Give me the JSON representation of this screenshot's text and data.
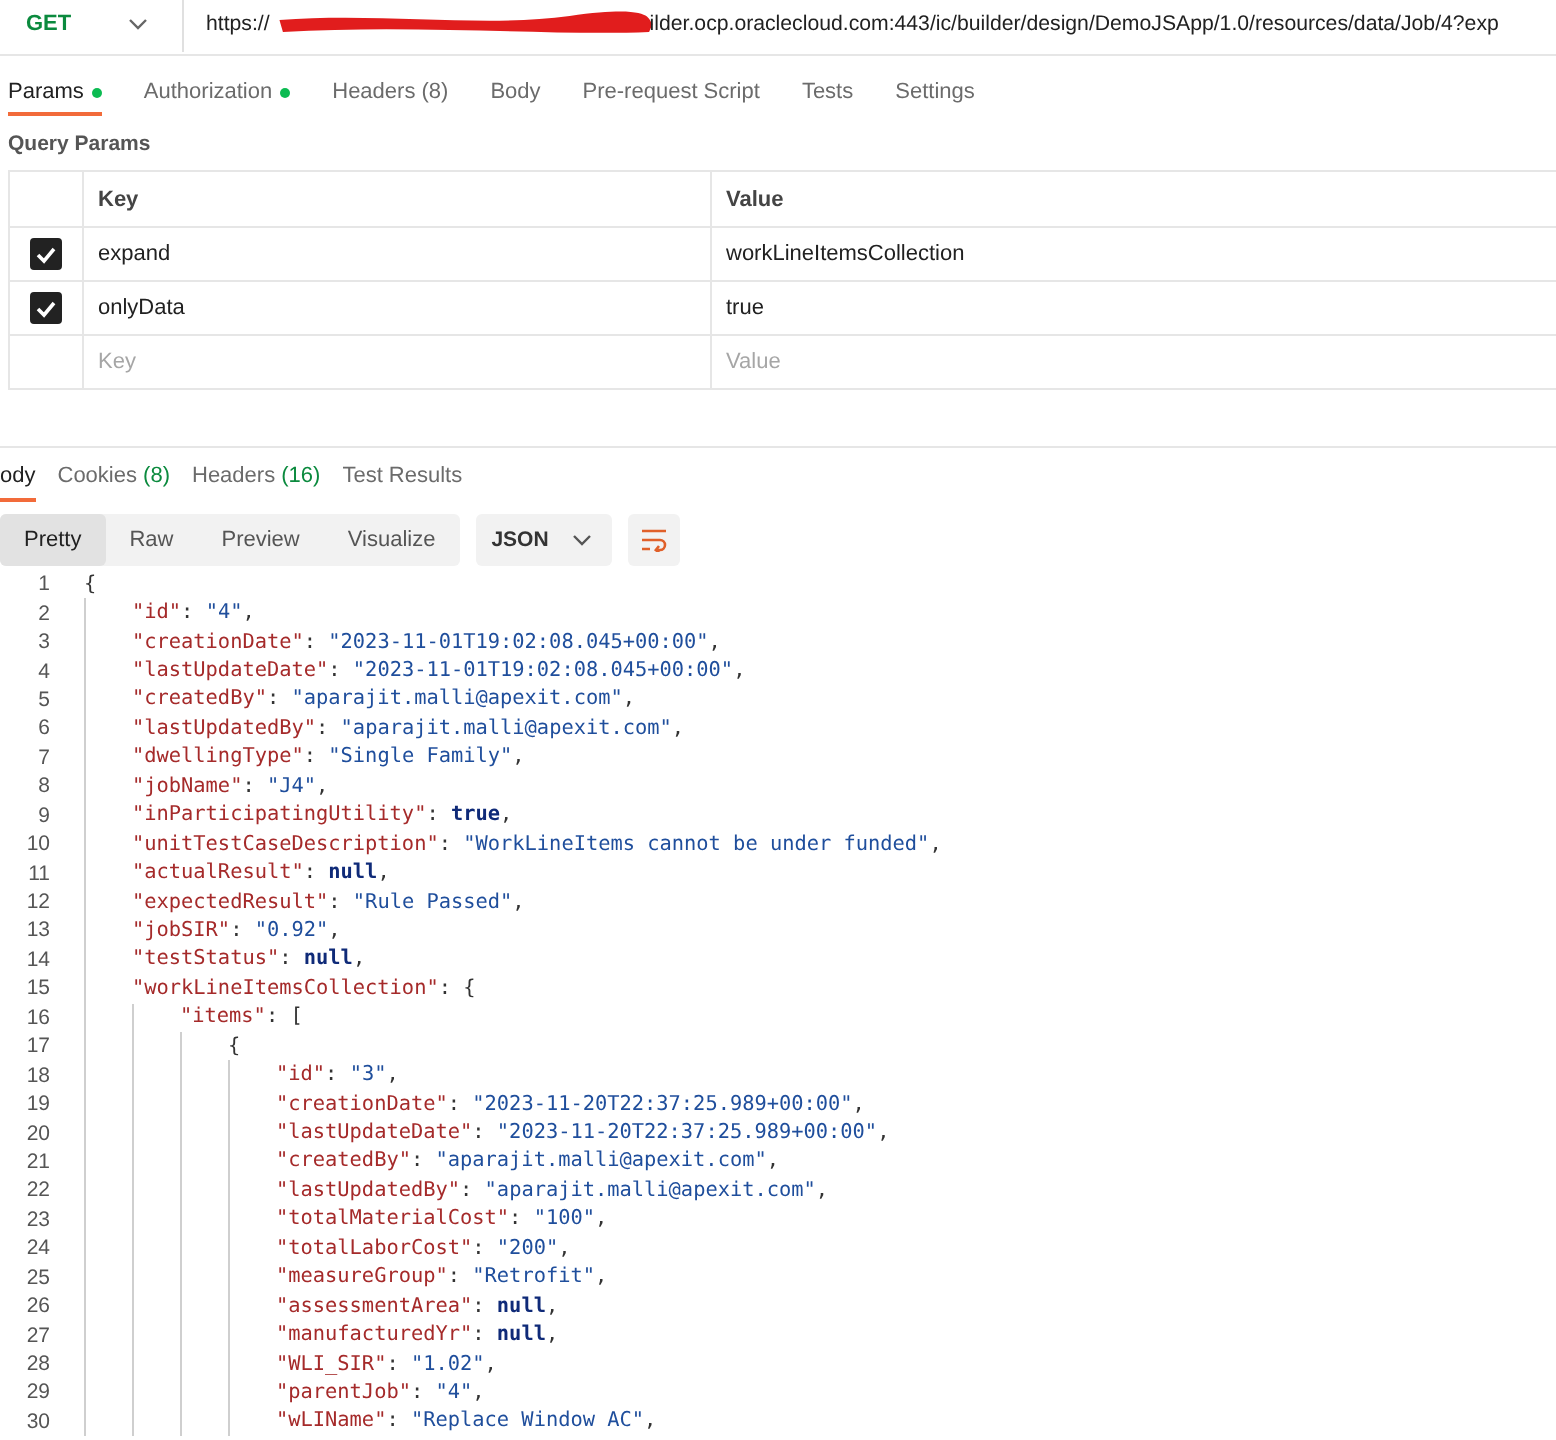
{
  "request": {
    "method": "GET",
    "url_start": "https://",
    "url_end": "ilder.ocp.oraclecloud.com:443/ic/builder/design/DemoJSApp/1.0/resources/data/Job/4?exp"
  },
  "request_tabs": [
    {
      "label": "Params",
      "selected": true,
      "dot": true
    },
    {
      "label": "Authorization",
      "selected": false,
      "dot": true
    },
    {
      "label": "Headers",
      "count": "(8)",
      "selected": false,
      "dot": false
    },
    {
      "label": "Body",
      "selected": false,
      "dot": false
    },
    {
      "label": "Pre-request Script",
      "selected": false,
      "dot": false
    },
    {
      "label": "Tests",
      "selected": false,
      "dot": false
    },
    {
      "label": "Settings",
      "selected": false,
      "dot": false
    }
  ],
  "query_params": {
    "title": "Query Params",
    "columns": [
      "Key",
      "Value"
    ],
    "rows": [
      {
        "checked": true,
        "key": "expand",
        "value": "workLineItemsCollection"
      },
      {
        "checked": true,
        "key": "onlyData",
        "value": "true"
      }
    ],
    "new_row": {
      "key_placeholder": "Key",
      "value_placeholder": "Value"
    }
  },
  "response_tabs": [
    {
      "label": "ody",
      "selected": true
    },
    {
      "label": "Cookies",
      "count": "(8)",
      "selected": false
    },
    {
      "label": "Headers",
      "count": "(16)",
      "selected": false
    },
    {
      "label": "Test Results",
      "selected": false
    }
  ],
  "view_modes": [
    {
      "label": "Pretty",
      "selected": true
    },
    {
      "label": "Raw",
      "selected": false
    },
    {
      "label": "Preview",
      "selected": false
    },
    {
      "label": "Visualize",
      "selected": false
    }
  ],
  "format": "JSON",
  "code": [
    {
      "n": "1",
      "tokens": [
        {
          "kind": "p",
          "text": "{"
        }
      ],
      "children": [
        {
          "n": "2",
          "tokens": [
            {
              "kind": "key",
              "text": "\"id\""
            },
            {
              "kind": "p",
              "text": ": "
            },
            {
              "kind": "str",
              "text": "\"4\""
            },
            {
              "kind": "p",
              "text": ","
            }
          ]
        },
        {
          "n": "3",
          "tokens": [
            {
              "kind": "key",
              "text": "\"creationDate\""
            },
            {
              "kind": "p",
              "text": ": "
            },
            {
              "kind": "str",
              "text": "\"2023-11-01T19:02:08.045+00:00\""
            },
            {
              "kind": "p",
              "text": ","
            }
          ]
        },
        {
          "n": "4",
          "tokens": [
            {
              "kind": "key",
              "text": "\"lastUpdateDate\""
            },
            {
              "kind": "p",
              "text": ": "
            },
            {
              "kind": "str",
              "text": "\"2023-11-01T19:02:08.045+00:00\""
            },
            {
              "kind": "p",
              "text": ","
            }
          ]
        },
        {
          "n": "5",
          "tokens": [
            {
              "kind": "key",
              "text": "\"createdBy\""
            },
            {
              "kind": "p",
              "text": ": "
            },
            {
              "kind": "str",
              "text": "\"aparajit.malli@apexit.com\""
            },
            {
              "kind": "p",
              "text": ","
            }
          ]
        },
        {
          "n": "6",
          "tokens": [
            {
              "kind": "key",
              "text": "\"lastUpdatedBy\""
            },
            {
              "kind": "p",
              "text": ": "
            },
            {
              "kind": "str",
              "text": "\"aparajit.malli@apexit.com\""
            },
            {
              "kind": "p",
              "text": ","
            }
          ]
        },
        {
          "n": "7",
          "tokens": [
            {
              "kind": "key",
              "text": "\"dwellingType\""
            },
            {
              "kind": "p",
              "text": ": "
            },
            {
              "kind": "str",
              "text": "\"Single Family\""
            },
            {
              "kind": "p",
              "text": ","
            }
          ]
        },
        {
          "n": "8",
          "tokens": [
            {
              "kind": "key",
              "text": "\"jobName\""
            },
            {
              "kind": "p",
              "text": ": "
            },
            {
              "kind": "str",
              "text": "\"J4\""
            },
            {
              "kind": "p",
              "text": ","
            }
          ]
        },
        {
          "n": "9",
          "tokens": [
            {
              "kind": "key",
              "text": "\"inParticipatingUtility\""
            },
            {
              "kind": "p",
              "text": ": "
            },
            {
              "kind": "kw",
              "text": "true"
            },
            {
              "kind": "p",
              "text": ","
            }
          ]
        },
        {
          "n": "10",
          "tokens": [
            {
              "kind": "key",
              "text": "\"unitTestCaseDescription\""
            },
            {
              "kind": "p",
              "text": ": "
            },
            {
              "kind": "str",
              "text": "\"WorkLineItems cannot be under funded\""
            },
            {
              "kind": "p",
              "text": ","
            }
          ]
        },
        {
          "n": "11",
          "tokens": [
            {
              "kind": "key",
              "text": "\"actualResult\""
            },
            {
              "kind": "p",
              "text": ": "
            },
            {
              "kind": "kw",
              "text": "null"
            },
            {
              "kind": "p",
              "text": ","
            }
          ]
        },
        {
          "n": "12",
          "tokens": [
            {
              "kind": "key",
              "text": "\"expectedResult\""
            },
            {
              "kind": "p",
              "text": ": "
            },
            {
              "kind": "str",
              "text": "\"Rule Passed\""
            },
            {
              "kind": "p",
              "text": ","
            }
          ]
        },
        {
          "n": "13",
          "tokens": [
            {
              "kind": "key",
              "text": "\"jobSIR\""
            },
            {
              "kind": "p",
              "text": ": "
            },
            {
              "kind": "str",
              "text": "\"0.92\""
            },
            {
              "kind": "p",
              "text": ","
            }
          ]
        },
        {
          "n": "14",
          "tokens": [
            {
              "kind": "key",
              "text": "\"testStatus\""
            },
            {
              "kind": "p",
              "text": ": "
            },
            {
              "kind": "kw",
              "text": "null"
            },
            {
              "kind": "p",
              "text": ","
            }
          ]
        },
        {
          "n": "15",
          "tokens": [
            {
              "kind": "key",
              "text": "\"workLineItemsCollection\""
            },
            {
              "kind": "p",
              "text": ": {"
            }
          ],
          "children": [
            {
              "n": "16",
              "tokens": [
                {
                  "kind": "key",
                  "text": "\"items\""
                },
                {
                  "kind": "p",
                  "text": ": ["
                }
              ],
              "children": [
                {
                  "n": "17",
                  "tokens": [
                    {
                      "kind": "p",
                      "text": "{"
                    }
                  ],
                  "children": [
                    {
                      "n": "18",
                      "tokens": [
                        {
                          "kind": "key",
                          "text": "\"id\""
                        },
                        {
                          "kind": "p",
                          "text": ": "
                        },
                        {
                          "kind": "str",
                          "text": "\"3\""
                        },
                        {
                          "kind": "p",
                          "text": ","
                        }
                      ]
                    },
                    {
                      "n": "19",
                      "tokens": [
                        {
                          "kind": "key",
                          "text": "\"creationDate\""
                        },
                        {
                          "kind": "p",
                          "text": ": "
                        },
                        {
                          "kind": "str",
                          "text": "\"2023-11-20T22:37:25.989+00:00\""
                        },
                        {
                          "kind": "p",
                          "text": ","
                        }
                      ]
                    },
                    {
                      "n": "20",
                      "tokens": [
                        {
                          "kind": "key",
                          "text": "\"lastUpdateDate\""
                        },
                        {
                          "kind": "p",
                          "text": ": "
                        },
                        {
                          "kind": "str",
                          "text": "\"2023-11-20T22:37:25.989+00:00\""
                        },
                        {
                          "kind": "p",
                          "text": ","
                        }
                      ]
                    },
                    {
                      "n": "21",
                      "tokens": [
                        {
                          "kind": "key",
                          "text": "\"createdBy\""
                        },
                        {
                          "kind": "p",
                          "text": ": "
                        },
                        {
                          "kind": "str",
                          "text": "\"aparajit.malli@apexit.com\""
                        },
                        {
                          "kind": "p",
                          "text": ","
                        }
                      ]
                    },
                    {
                      "n": "22",
                      "tokens": [
                        {
                          "kind": "key",
                          "text": "\"lastUpdatedBy\""
                        },
                        {
                          "kind": "p",
                          "text": ": "
                        },
                        {
                          "kind": "str",
                          "text": "\"aparajit.malli@apexit.com\""
                        },
                        {
                          "kind": "p",
                          "text": ","
                        }
                      ]
                    },
                    {
                      "n": "23",
                      "tokens": [
                        {
                          "kind": "key",
                          "text": "\"totalMaterialCost\""
                        },
                        {
                          "kind": "p",
                          "text": ": "
                        },
                        {
                          "kind": "str",
                          "text": "\"100\""
                        },
                        {
                          "kind": "p",
                          "text": ","
                        }
                      ]
                    },
                    {
                      "n": "24",
                      "tokens": [
                        {
                          "kind": "key",
                          "text": "\"totalLaborCost\""
                        },
                        {
                          "kind": "p",
                          "text": ": "
                        },
                        {
                          "kind": "str",
                          "text": "\"200\""
                        },
                        {
                          "kind": "p",
                          "text": ","
                        }
                      ]
                    },
                    {
                      "n": "25",
                      "tokens": [
                        {
                          "kind": "key",
                          "text": "\"measureGroup\""
                        },
                        {
                          "kind": "p",
                          "text": ": "
                        },
                        {
                          "kind": "str",
                          "text": "\"Retrofit\""
                        },
                        {
                          "kind": "p",
                          "text": ","
                        }
                      ]
                    },
                    {
                      "n": "26",
                      "tokens": [
                        {
                          "kind": "key",
                          "text": "\"assessmentArea\""
                        },
                        {
                          "kind": "p",
                          "text": ": "
                        },
                        {
                          "kind": "kw",
                          "text": "null"
                        },
                        {
                          "kind": "p",
                          "text": ","
                        }
                      ]
                    },
                    {
                      "n": "27",
                      "tokens": [
                        {
                          "kind": "key",
                          "text": "\"manufacturedYr\""
                        },
                        {
                          "kind": "p",
                          "text": ": "
                        },
                        {
                          "kind": "kw",
                          "text": "null"
                        },
                        {
                          "kind": "p",
                          "text": ","
                        }
                      ]
                    },
                    {
                      "n": "28",
                      "tokens": [
                        {
                          "kind": "key",
                          "text": "\"WLI_SIR\""
                        },
                        {
                          "kind": "p",
                          "text": ": "
                        },
                        {
                          "kind": "str",
                          "text": "\"1.02\""
                        },
                        {
                          "kind": "p",
                          "text": ","
                        }
                      ]
                    },
                    {
                      "n": "29",
                      "tokens": [
                        {
                          "kind": "key",
                          "text": "\"parentJob\""
                        },
                        {
                          "kind": "p",
                          "text": ": "
                        },
                        {
                          "kind": "str",
                          "text": "\"4\""
                        },
                        {
                          "kind": "p",
                          "text": ","
                        }
                      ]
                    },
                    {
                      "n": "30",
                      "tokens": [
                        {
                          "kind": "key",
                          "text": "\"wLIName\""
                        },
                        {
                          "kind": "p",
                          "text": ": "
                        },
                        {
                          "kind": "str",
                          "text": "\"Replace Window AC\""
                        },
                        {
                          "kind": "p",
                          "text": ","
                        }
                      ]
                    }
                  ]
                }
              ]
            }
          ]
        }
      ]
    }
  ]
}
